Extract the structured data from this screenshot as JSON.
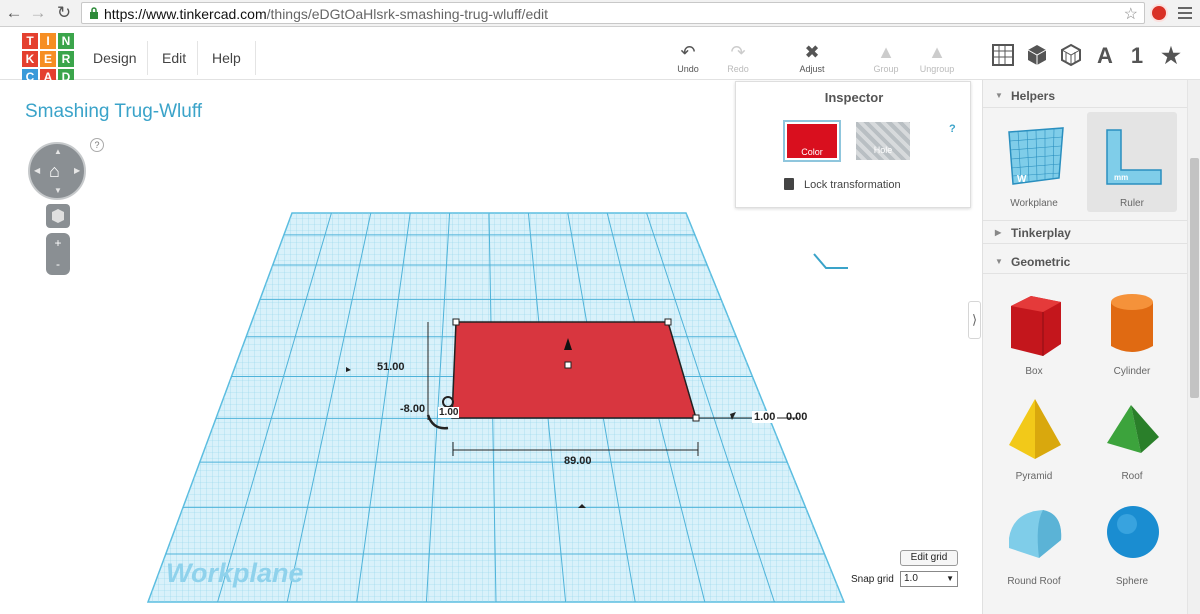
{
  "browser": {
    "url_host": "https://www.tinkercad.com",
    "url_path": "/things/eDGtOaHlsrk-smashing-trug-wluff/edit"
  },
  "logo": {
    "letters": [
      "T",
      "I",
      "N",
      "K",
      "E",
      "R",
      "C",
      "A",
      "D"
    ],
    "colors": [
      "#e4402f",
      "#f68e23",
      "#3ba54b",
      "#e4402f",
      "#f68e23",
      "#3ba54b",
      "#3a9ad9",
      "#e4402f",
      "#3ba54b"
    ]
  },
  "menu": {
    "design": "Design",
    "edit": "Edit",
    "help": "Help"
  },
  "toolbar": {
    "undo": "Undo",
    "redo": "Redo",
    "adjust": "Adjust",
    "group": "Group",
    "ungroup": "Ungroup"
  },
  "view_icons": {
    "grid": "grid-view-icon",
    "box": "box-view-icon",
    "wire": "wireframe-view-icon",
    "letter": "A",
    "number": "1",
    "star": "star-icon"
  },
  "design": {
    "title": "Smashing Trug-Wluff",
    "help": "?"
  },
  "inspector": {
    "title": "Inspector",
    "help": "?",
    "color_label": "Color",
    "hole_label": "Hole",
    "lock_label": "Lock transformation",
    "color_value": "#d90f1e"
  },
  "dimensions": {
    "depth": "51.00",
    "width": "89.00",
    "height": "1.00",
    "height_right": "1.00",
    "elevation": "0.00",
    "offset": "-8.00"
  },
  "workplane": {
    "label": "Workplane",
    "edit_grid": "Edit grid",
    "snap_label": "Snap grid",
    "snap_value": "1.0"
  },
  "panel": {
    "sections": {
      "helpers": "Helpers",
      "tinkerplay": "Tinkerplay",
      "geometric": "Geometric"
    },
    "helpers": [
      {
        "label": "Workplane"
      },
      {
        "label": "Ruler"
      }
    ],
    "geometric": [
      {
        "label": "Box"
      },
      {
        "label": "Cylinder"
      },
      {
        "label": "Pyramid"
      },
      {
        "label": "Roof"
      },
      {
        "label": "Round Roof"
      },
      {
        "label": "Sphere"
      }
    ]
  }
}
